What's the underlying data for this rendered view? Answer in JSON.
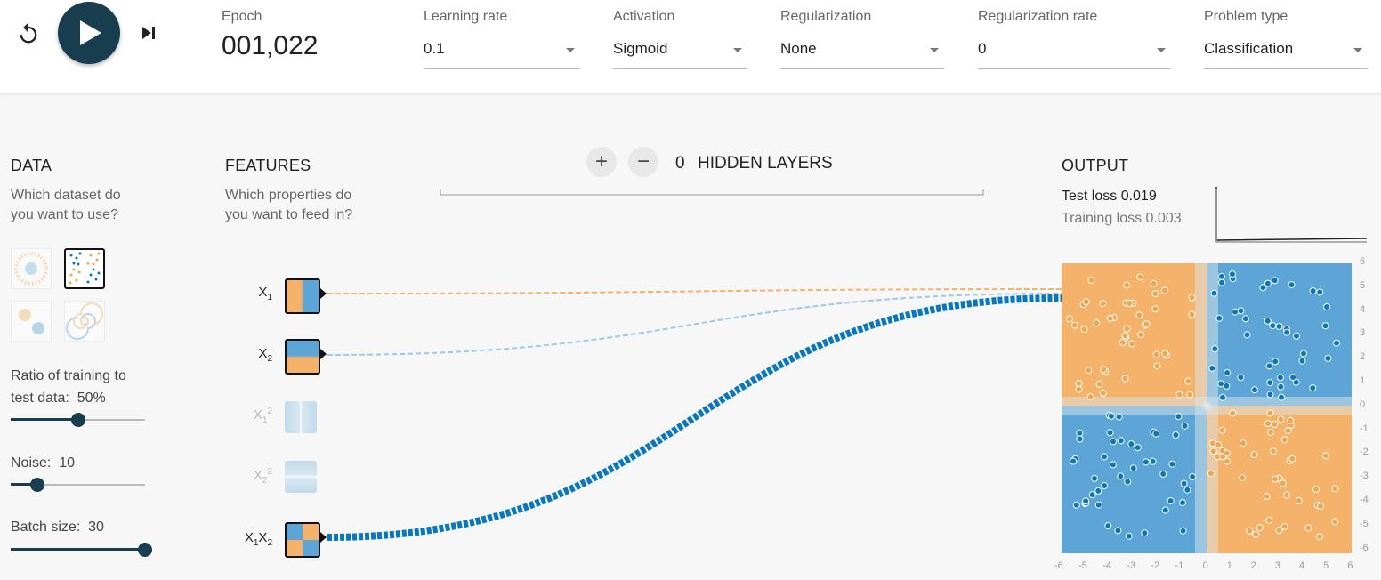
{
  "header": {
    "epoch_label": "Epoch",
    "epoch_value": "001,022",
    "learning_rate": {
      "label": "Learning rate",
      "value": "0.1"
    },
    "activation": {
      "label": "Activation",
      "value": "Sigmoid"
    },
    "regularization": {
      "label": "Regularization",
      "value": "None"
    },
    "regularization_rate": {
      "label": "Regularization rate",
      "value": "0"
    },
    "problem_type": {
      "label": "Problem type",
      "value": "Classification"
    }
  },
  "icons": {
    "reset": "reset-icon",
    "play": "play-icon",
    "step": "step-forward-icon"
  },
  "data_section": {
    "title": "DATA",
    "subtitle_line1": "Which dataset do",
    "subtitle_line2": "you want to use?",
    "datasets": [
      "circle",
      "xor",
      "gaussian",
      "spiral"
    ],
    "selected_dataset": "xor",
    "ratio_label_line1": "Ratio of training to",
    "ratio_label_line2": "test data:",
    "ratio_value": "50%",
    "ratio_level": 0.5,
    "noise_label": "Noise:",
    "noise_value": "10",
    "noise_level": 0.2,
    "batch_label": "Batch size:",
    "batch_value": "30",
    "batch_level": 1.0
  },
  "features_section": {
    "title": "FEATURES",
    "subtitle_line1": "Which properties do",
    "subtitle_line2": "you want to feed in?",
    "features": [
      {
        "base": "X",
        "sub": "1",
        "sup": "",
        "active": true
      },
      {
        "base": "X",
        "sub": "2",
        "sup": "",
        "active": true
      },
      {
        "base": "X",
        "sub": "1",
        "sup": "2",
        "active": false
      },
      {
        "base": "X",
        "sub": "2",
        "sup": "2",
        "active": false
      },
      {
        "base": "X",
        "sub": "1",
        "base2": "X",
        "sub2": "2",
        "active": true
      }
    ]
  },
  "hidden_layers": {
    "count": "0",
    "label": "HIDDEN LAYERS",
    "add_symbol": "+",
    "remove_symbol": "−"
  },
  "output_section": {
    "title": "OUTPUT",
    "test_loss": "Test loss 0.019",
    "training_loss": "Training loss 0.003",
    "y_ticks": [
      "6",
      "5",
      "4",
      "3",
      "2",
      "1",
      "0",
      "-1",
      "-2",
      "-3",
      "-4",
      "-5",
      "-6"
    ],
    "x_ticks": [
      "-6",
      "-5",
      "-4",
      "-3",
      "-2",
      "-1",
      "0",
      "1",
      "2",
      "3",
      "4",
      "5",
      "6"
    ]
  },
  "colors": {
    "orange": "#f4b26b",
    "blue": "#5da5d6",
    "dark_blue": "#0877bd",
    "accent": "#183d4e"
  }
}
